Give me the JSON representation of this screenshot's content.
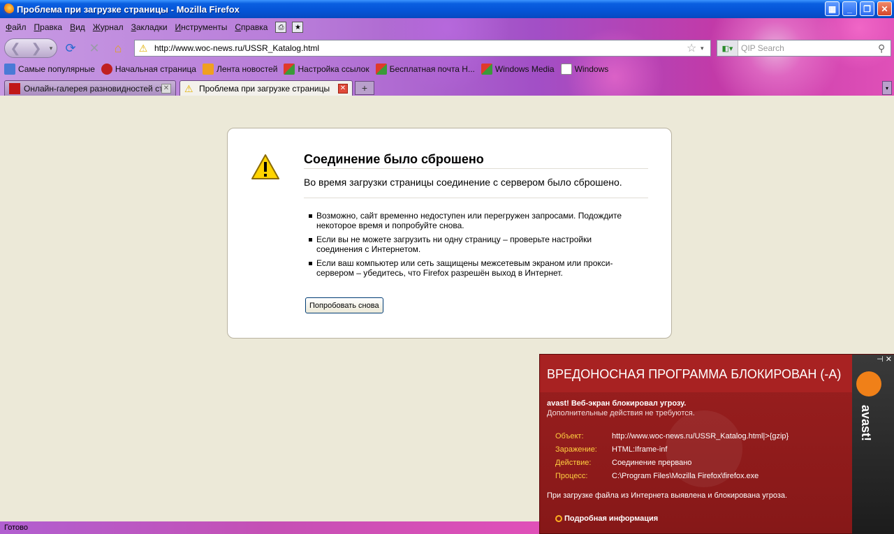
{
  "window": {
    "title": "Проблема при загрузке страницы - Mozilla Firefox"
  },
  "menu": {
    "items": [
      "Файл",
      "Правка",
      "Вид",
      "Журнал",
      "Закладки",
      "Инструменты",
      "Справка"
    ]
  },
  "navbar": {
    "url": "http://www.woc-news.ru/USSR_Katalog.html",
    "search_placeholder": "QIP Search"
  },
  "bookmarks": {
    "items": [
      {
        "label": "Самые популярные",
        "icon": "popular-icon",
        "color": "#4a7ad6"
      },
      {
        "label": "Начальная страница",
        "icon": "bird-icon",
        "color": "#c02020"
      },
      {
        "label": "Лента новостей",
        "icon": "rss-icon",
        "color": "#f0a020"
      },
      {
        "label": "Настройка ссылок",
        "icon": "windows-flag-icon",
        "color": "#3a9a3a"
      },
      {
        "label": "Бесплатная почта H...",
        "icon": "windows-flag-icon",
        "color": "#3a9a3a"
      },
      {
        "label": "Windows Media",
        "icon": "windows-flag-icon",
        "color": "#3a9a3a"
      },
      {
        "label": "Windows",
        "icon": "page-icon",
        "color": "#ffffff"
      }
    ]
  },
  "tabs": [
    {
      "label": "Онлайн-галерея разновидностей ста...",
      "icon": "ussr-flag-icon",
      "active": false
    },
    {
      "label": "Проблема при загрузке страницы",
      "icon": "warning-icon",
      "active": true
    }
  ],
  "error_page": {
    "title": "Соединение было сброшено",
    "description": "Во время загрузки страницы соединение с сервером было сброшено.",
    "bullets": [
      "Возможно, сайт временно недоступен или перегружен запросами. Подождите некоторое время и попробуйте снова.",
      "Если вы не можете загрузить ни одну страницу – проверьте настройки соединения с Интернетом.",
      "Если ваш компьютер или сеть защищены межсетевым экраном или прокси-сервером – убедитесь, что Firefox разрешён выход в Интернет."
    ],
    "retry_label": "Попробовать снова"
  },
  "avast": {
    "header": "ВРЕДОНОСНАЯ ПРОГРАММА БЛОКИРОВАН (-А)",
    "brand": "avast!",
    "threat_line": "avast! Веб-экран блокировал угрозу.",
    "no_action_line": "Дополнительные действия не требуются.",
    "details": [
      {
        "key": "Объект:",
        "value": "http://www.woc-news.ru/USSR_Katalog.html|>{gzip}"
      },
      {
        "key": "Заражение:",
        "value": "HTML:Iframe-inf"
      },
      {
        "key": "Действие:",
        "value": "Соединение прервано"
      },
      {
        "key": "Процесс:",
        "value": "C:\\Program Files\\Mozilla Firefox\\firefox.exe"
      }
    ],
    "summary": "При загрузке файла из Интернета выявлена и блокирована угроза.",
    "more_info": "Подробная информация",
    "colors": {
      "panel": "#9b1f1f",
      "key": "#ffd040",
      "logo": "#f08018"
    }
  },
  "status": {
    "text": "Готово"
  }
}
